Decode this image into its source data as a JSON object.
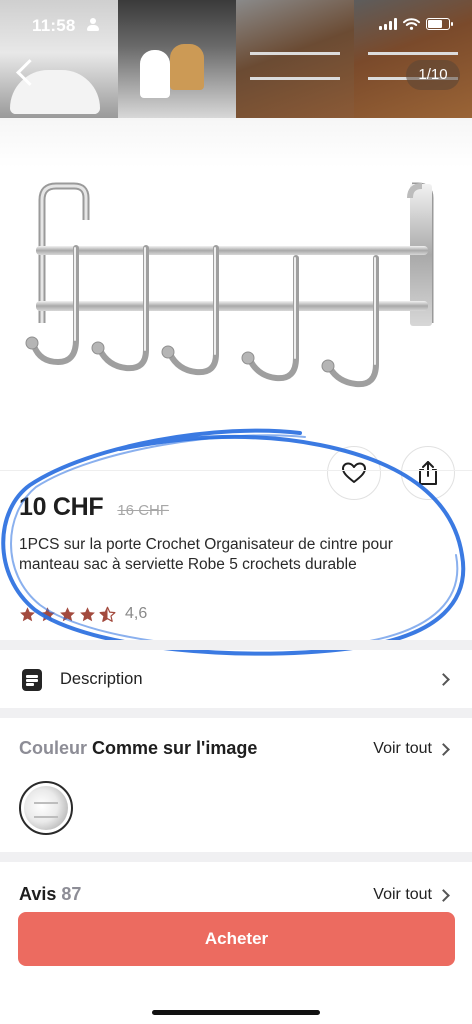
{
  "status_bar": {
    "time": "11:58"
  },
  "gallery": {
    "counter": "1/10"
  },
  "product": {
    "price": "10 CHF",
    "old_price": "16 CHF",
    "title": "1PCS sur la porte Crochet Organisateur de cintre pour manteau sac à serviette Robe 5 crochets durable",
    "rating_value": "4,6",
    "rating_stars": 4.5
  },
  "description": {
    "label": "Description",
    "icon": "document-icon"
  },
  "color": {
    "key_label": "Couleur",
    "value_label": "Comme sur l'image",
    "see_all_label": "Voir tout"
  },
  "reviews": {
    "label": "Avis",
    "count": "87",
    "see_all_label": "Voir tout"
  },
  "actions": {
    "buy_label": "Acheter"
  },
  "colors": {
    "buy_button": "#ec6b60",
    "star": "#a34a3e",
    "annotation": "#2a6fe0"
  }
}
